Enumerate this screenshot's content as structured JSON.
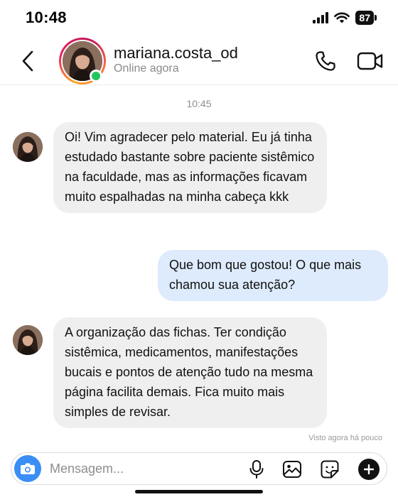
{
  "status_bar": {
    "time": "10:48",
    "battery": "87"
  },
  "header": {
    "contact_name": "mariana.costa_od",
    "contact_status": "Online agora",
    "icons": {
      "back": "chevron-left-icon",
      "call": "phone-icon",
      "video": "video-camera-icon"
    },
    "online_color": "#22c55e"
  },
  "conversation": {
    "time_divider": "10:45",
    "messages": [
      {
        "direction": "incoming",
        "text": "Oi! Vim agradecer pelo material. Eu já tinha estudado bastante sobre paciente sistêmico na faculdade, mas as informações ficavam muito espalhadas na minha cabeça kkk"
      },
      {
        "direction": "outgoing",
        "text": "Que bom que gostou! O que mais chamou sua atenção?"
      },
      {
        "direction": "incoming",
        "text": "A organização das fichas. Ter condição sistêmica, medicamentos, manifestações bucais e pontos de atenção tudo na mesma página facilita demais. Fica muito mais simples de revisar."
      }
    ],
    "seen_text": "Visto agora há pouco"
  },
  "composer": {
    "placeholder": "Mensagem...",
    "icons": {
      "camera": "camera-icon",
      "mic": "microphone-icon",
      "gallery": "image-icon",
      "sticker": "sticker-icon",
      "more": "plus-icon"
    },
    "accent_color": "#3b8ef5"
  },
  "colors": {
    "incoming_bubble": "#efefef",
    "outgoing_bubble": "#ddebfc"
  }
}
